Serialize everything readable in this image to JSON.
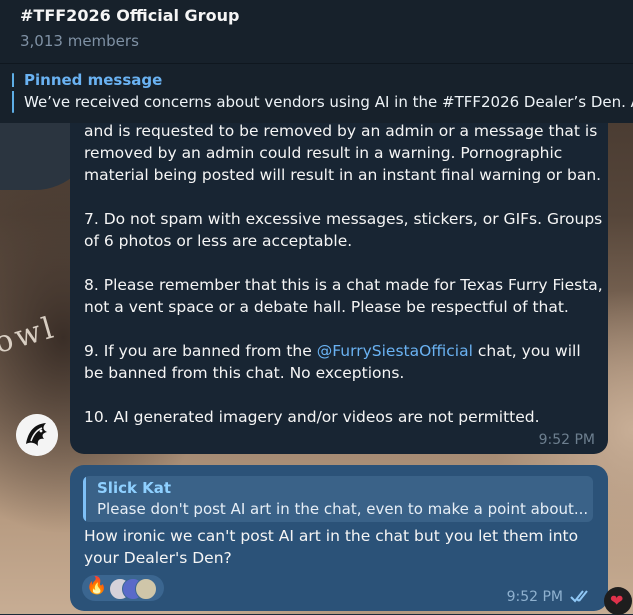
{
  "header": {
    "title": "#TFF2026 Official Group",
    "members": "3,013 members"
  },
  "pinned": {
    "label": "Pinned message",
    "text": "We’ve received concerns about vendors using AI in the #TFF2026 Dealer’s Den.  A"
  },
  "wallpaper": {
    "text": "owl"
  },
  "message1": {
    "p1": "and is requested to be removed by an admin or a message that is removed by an admin could result in a warning. Pornographic material being posted will result in an instant final warning or ban.",
    "p2": "7. Do not spam with excessive messages, stickers, or GIFs. Groups of 6 photos or less are acceptable.",
    "p3": "8. Please remember that this is a chat made for Texas Furry Fiesta, not a vent space or a debate hall. Please be respectful of that.",
    "p4_before": "9. If you are banned from the ",
    "p4_mention": "@FurrySiestaOfficial",
    "p4_after": " chat, you will be banned from this chat. No exceptions.",
    "p5": "10. AI generated imagery and/or videos are not permitted.",
    "time": "9:52 PM"
  },
  "message2": {
    "reply_name": "Slick Kat",
    "reply_text": "Please don't post AI art in the chat, even to make a point about...",
    "text": "How ironic we can't post AI art in the chat but you let them into your Dealer's Den?",
    "time": "9:52 PM",
    "reactions": [
      "fire-emoji",
      "reactor-avatar",
      "reactor-avatar",
      "reactor-avatar"
    ],
    "status": "read-double-check"
  },
  "colors": {
    "header_bg": "#17212b",
    "incoming_bubble": "#182533",
    "outgoing_bubble": "#2b5278",
    "link": "#6ab2f2"
  }
}
